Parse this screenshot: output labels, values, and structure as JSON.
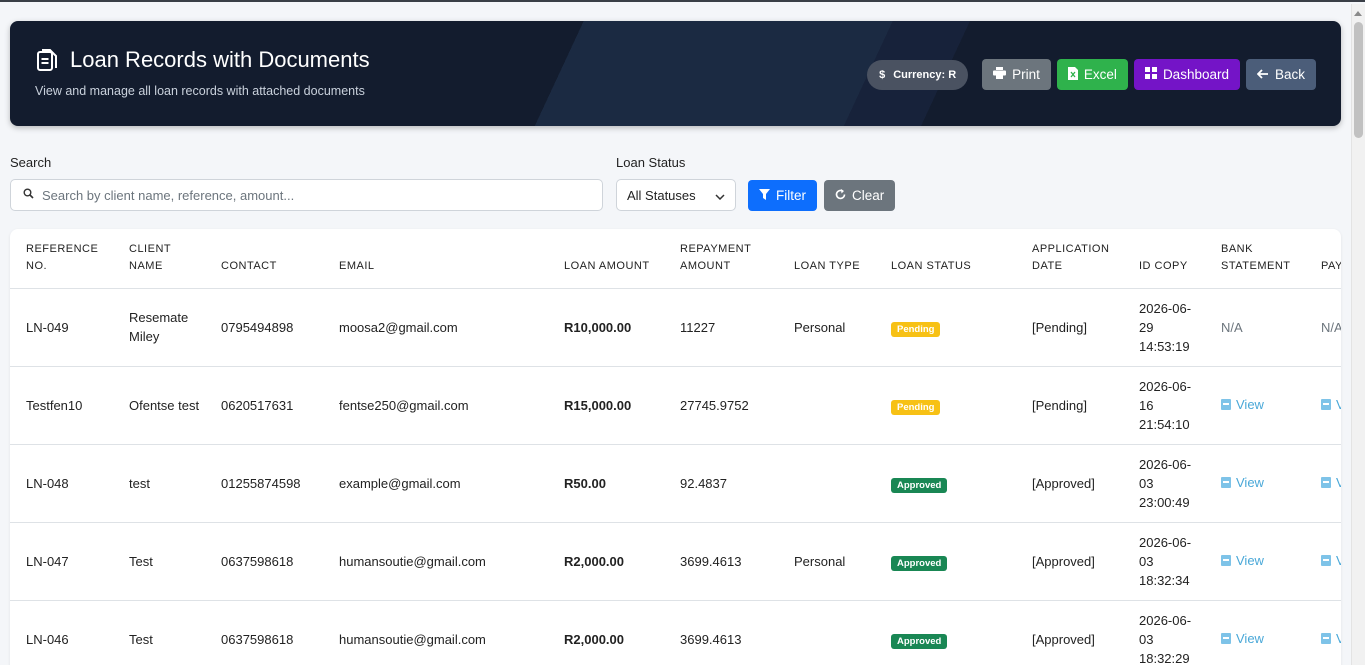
{
  "header": {
    "title": "Loan Records with Documents",
    "subtitle": "View and manage all loan records with attached documents",
    "currency": "Currency: R",
    "buttons": {
      "print": "Print",
      "excel": "Excel",
      "dashboard": "Dashboard",
      "back": "Back"
    }
  },
  "filters": {
    "search_label": "Search",
    "search_placeholder": "Search by client name, reference, amount...",
    "status_label": "Loan Status",
    "status_selected": "All Statuses",
    "filter_label": "Filter",
    "clear_label": "Clear"
  },
  "table": {
    "columns": [
      "REFERENCE NO.",
      "CLIENT NAME",
      "CONTACT",
      "EMAIL",
      "LOAN AMOUNT",
      "REPAYMENT AMOUNT",
      "LOAN TYPE",
      "LOAN STATUS",
      "APPLICATION DATE",
      "ID COPY",
      "BANK STATEMENT",
      "PAY"
    ],
    "rows": [
      {
        "ref": "LN-049",
        "client": "Resemate Miley",
        "contact": "0795494898",
        "email": "moosa2@gmail.com",
        "loan": "R10,000.00",
        "repay": "11227",
        "type": "Personal",
        "status": "Pending",
        "status_kind": "pending",
        "app": "[Pending]",
        "date": "2026-06-29",
        "time": "14:53:19",
        "bank": "N/A",
        "pay": "N/A"
      },
      {
        "ref": "Testfen10",
        "client": "Ofentse test",
        "contact": "0620517631",
        "email": "fentse250@gmail.com",
        "loan": "R15,000.00",
        "repay": "27745.9752",
        "type": "",
        "status": "Pending",
        "status_kind": "pending",
        "app": "[Pending]",
        "date": "2026-06-16",
        "time": "21:54:10",
        "bank": "View",
        "pay": "View"
      },
      {
        "ref": "LN-048",
        "client": "test",
        "contact": "01255874598",
        "email": "example@gmail.com",
        "loan": "R50.00",
        "repay": "92.4837",
        "type": "",
        "status": "Approved",
        "status_kind": "approved",
        "app": "[Approved]",
        "date": "2026-06-03",
        "time": "23:00:49",
        "bank": "View",
        "pay": "View"
      },
      {
        "ref": "LN-047",
        "client": "Test",
        "contact": "0637598618",
        "email": "humansoutie@gmail.com",
        "loan": "R2,000.00",
        "repay": "3699.4613",
        "type": "Personal",
        "status": "Approved",
        "status_kind": "approved",
        "app": "[Approved]",
        "date": "2026-06-03",
        "time": "18:32:34",
        "bank": "View",
        "pay": "View"
      },
      {
        "ref": "LN-046",
        "client": "Test",
        "contact": "0637598618",
        "email": "humansoutie@gmail.com",
        "loan": "R2,000.00",
        "repay": "3699.4613",
        "type": "",
        "status": "Approved",
        "status_kind": "approved",
        "app": "[Approved]",
        "date": "2026-06-03",
        "time": "18:32:29",
        "bank": "View",
        "pay": "View"
      }
    ]
  }
}
